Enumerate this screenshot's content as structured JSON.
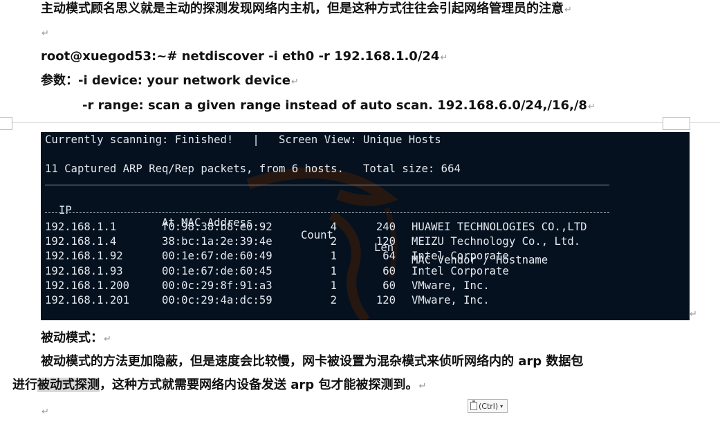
{
  "doc": {
    "intro": "主动模式顾名思义就是主动的探测发现网络内主机，但是这种方式往往会引起网络管理员的注意",
    "command": "root@xuegod53:~# netdiscover -i eth0 -r 192.168.1.0/24",
    "params_label": "参数：",
    "param_i": "-i device: your network device",
    "param_r": "-r range: scan a given range instead of auto scan. 192.168.6.0/24,/16,/8",
    "passive_heading": "被动模式：",
    "passive_line1": "被动模式的方法更加隐蔽，但是速度会比较慢，网卡被设置为混杂模式来侦听网络内的 arp 数据包",
    "passive_line2_pre": "进行",
    "passive_line2_hl": "被动式探测",
    "passive_line2_post": "，这种方式就需要网络内设备发送 arp 包才能被探测到。",
    "paragraph_mark": "↵",
    "paste_options": "(Ctrl)"
  },
  "terminal": {
    "status": "Currently scanning: Finished!   |   Screen View: Unique Hosts",
    "summary": "11 Captured ARP Req/Rep packets, from 6 hosts.   Total size: 664",
    "headers": {
      "ip": "IP",
      "mac": "At MAC Address",
      "count": "Count",
      "len": "Len",
      "vendor": "MAC Vendor / Hostname"
    },
    "rows": [
      {
        "ip": "192.168.1.1",
        "mac": "f0:98:38:b8:e0:92",
        "count": "4",
        "len": "240",
        "vendor": "HUAWEI TECHNOLOGIES CO.,LTD"
      },
      {
        "ip": "192.168.1.4",
        "mac": "38:bc:1a:2e:39:4e",
        "count": "2",
        "len": "120",
        "vendor": "MEIZU Technology Co., Ltd."
      },
      {
        "ip": "192.168.1.92",
        "mac": "00:1e:67:de:60:49",
        "count": "1",
        "len": "64",
        "vendor": "Intel Corporate"
      },
      {
        "ip": "192.168.1.93",
        "mac": "00:1e:67:de:60:45",
        "count": "1",
        "len": "60",
        "vendor": "Intel Corporate"
      },
      {
        "ip": "192.168.1.200",
        "mac": "00:0c:29:8f:91:a3",
        "count": "1",
        "len": "60",
        "vendor": "VMware, Inc."
      },
      {
        "ip": "192.168.1.201",
        "mac": "00:0c:29:4a:dc:59",
        "count": "2",
        "len": "120",
        "vendor": "VMware, Inc."
      }
    ],
    "background_color": "#05111f",
    "text_color": "#e4e8ee"
  },
  "icons": {
    "clipboard": "clipboard-icon",
    "dropdown": "chevron-down-icon",
    "paragraph": "paragraph-mark-icon"
  }
}
